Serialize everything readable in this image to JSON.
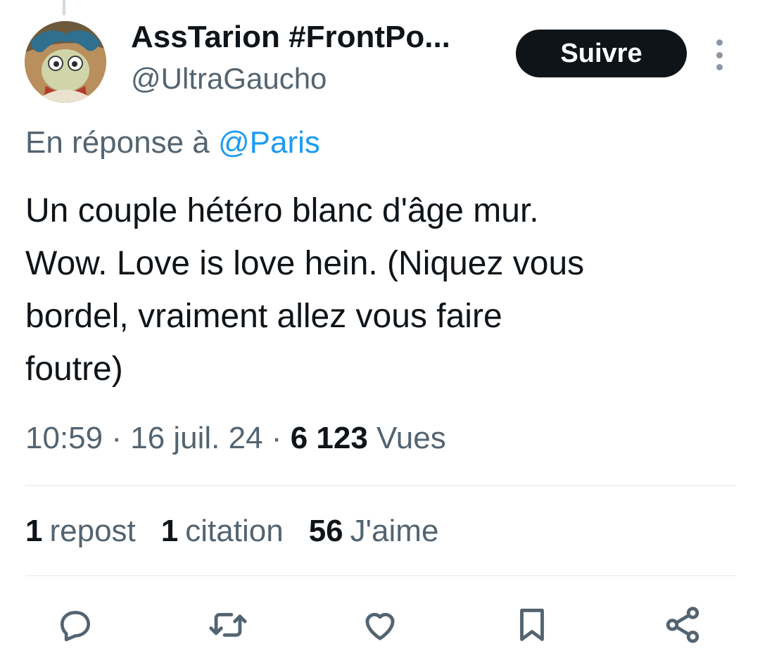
{
  "author": {
    "name": "AssTarion #FrontPo...",
    "handle": "@UltraGaucho",
    "avatar_icon": "cartoon-creature-avatar"
  },
  "follow_label": "Suivre",
  "reply": {
    "prefix": "En réponse à ",
    "mention": "@Paris"
  },
  "tweet": {
    "lines": [
      "Un couple hétéro blanc d'âge mur.",
      "Wow. Love is love hein. (Niquez vous",
      "bordel, vraiment allez vous faire",
      "foutre)"
    ]
  },
  "meta": {
    "time": "10:59",
    "separator": " · ",
    "date": "16 juil. 24",
    "views_count": "6 123",
    "views_label": "Vues"
  },
  "stats": {
    "reposts_count": "1",
    "reposts_label": "repost",
    "quotes_count": "1",
    "quotes_label": "citation",
    "likes_count": "56",
    "likes_label": "J'aime"
  },
  "actions": [
    "reply-icon",
    "repost-icon",
    "like-icon",
    "bookmark-icon",
    "share-icon"
  ],
  "colors": {
    "text": "#0f1419",
    "secondary": "#536471",
    "link": "#1d9bf0",
    "button_bg": "#0f1419",
    "divider": "#eff3f4"
  }
}
